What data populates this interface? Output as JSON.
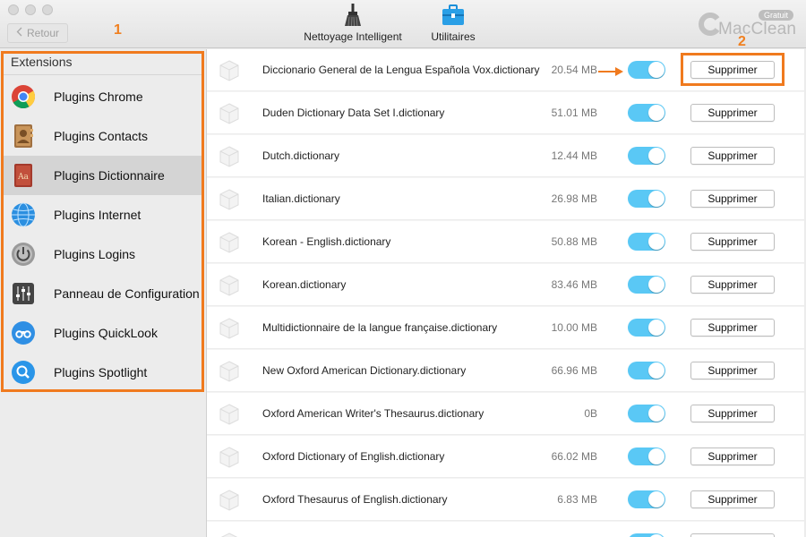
{
  "toolbar": {
    "back_label": "Retour",
    "tools": [
      {
        "label": "Nettoyage Intelligent",
        "icon": "broom-icon"
      },
      {
        "label": "Utilitaires",
        "icon": "toolbox-icon"
      }
    ],
    "logo_name": "MacClean",
    "logo_badge": "Gratuit"
  },
  "annotations": {
    "one": "1",
    "two": "2"
  },
  "sidebar": {
    "header": "Extensions",
    "items": [
      {
        "label": "Plugins Chrome",
        "icon": "chrome-icon"
      },
      {
        "label": "Plugins Contacts",
        "icon": "contacts-icon"
      },
      {
        "label": "Plugins Dictionnaire",
        "icon": "dictionary-icon",
        "active": true
      },
      {
        "label": "Plugins Internet",
        "icon": "globe-icon"
      },
      {
        "label": "Plugins Logins",
        "icon": "power-icon"
      },
      {
        "label": "Panneau de Configuration",
        "icon": "sliders-icon"
      },
      {
        "label": "Plugins QuickLook",
        "icon": "binoculars-icon"
      },
      {
        "label": "Plugins Spotlight",
        "icon": "spotlight-icon"
      }
    ]
  },
  "list": {
    "delete_label": "Supprimer",
    "items": [
      {
        "name": "Diccionario General de la Lengua Española Vox.dictionary",
        "size": "20.54 MB",
        "enabled": true
      },
      {
        "name": "Duden Dictionary Data Set I.dictionary",
        "size": "51.01 MB",
        "enabled": true
      },
      {
        "name": "Dutch.dictionary",
        "size": "12.44 MB",
        "enabled": true
      },
      {
        "name": "Italian.dictionary",
        "size": "26.98 MB",
        "enabled": true
      },
      {
        "name": "Korean - English.dictionary",
        "size": "50.88 MB",
        "enabled": true
      },
      {
        "name": "Korean.dictionary",
        "size": "83.46 MB",
        "enabled": true
      },
      {
        "name": "Multidictionnaire de la langue française.dictionary",
        "size": "10.00 MB",
        "enabled": true
      },
      {
        "name": "New Oxford American Dictionary.dictionary",
        "size": "66.96 MB",
        "enabled": true
      },
      {
        "name": "Oxford American Writer's Thesaurus.dictionary",
        "size": "0B",
        "enabled": true
      },
      {
        "name": "Oxford Dictionary of English.dictionary",
        "size": "66.02 MB",
        "enabled": true
      },
      {
        "name": "Oxford Thesaurus of English.dictionary",
        "size": "6.83 MB",
        "enabled": true
      }
    ]
  },
  "colors": {
    "accent_orange": "#f07a1e",
    "toggle_on": "#5ac8f5"
  }
}
